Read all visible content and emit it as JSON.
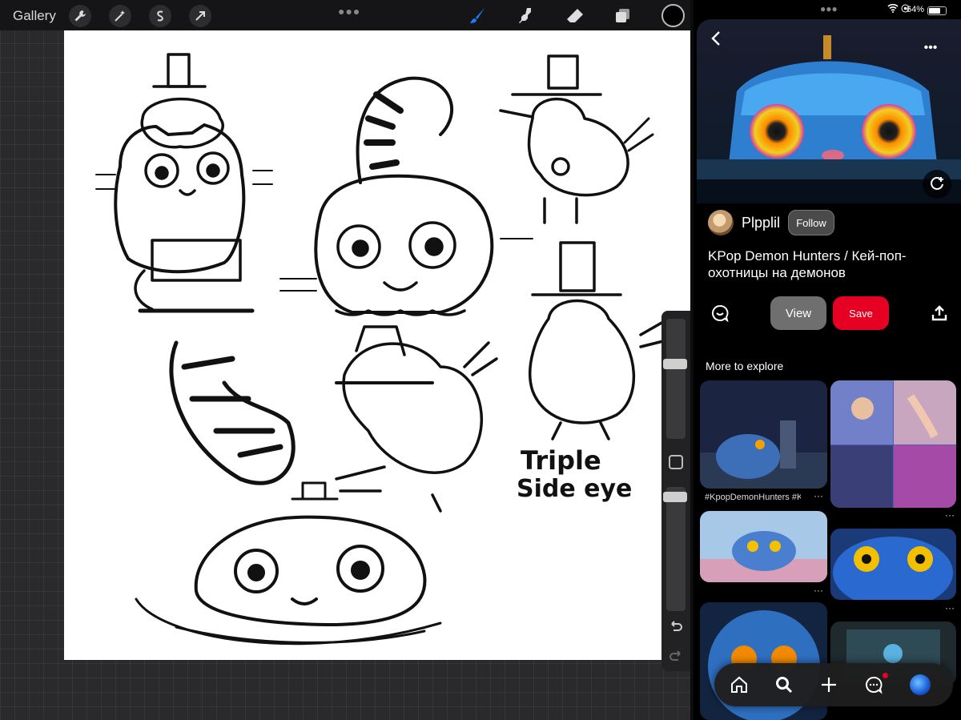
{
  "drawing_app": {
    "gallery_label": "Gallery",
    "toolbar_tools": [
      "wrench-icon",
      "magic-wand-icon",
      "selection-icon",
      "transform-arrow-icon"
    ],
    "right_tools": [
      "brush-icon",
      "smudge-icon",
      "eraser-icon",
      "layers-icon"
    ],
    "accent_color": "#1e7cff",
    "current_color": "#000000",
    "canvas_text": [
      "Triple",
      "Side eye"
    ]
  },
  "pin_viewer": {
    "status": {
      "battery_percent": "64%"
    },
    "author": {
      "name": "Plpplil",
      "follow_label": "Follow"
    },
    "title": "KPop Demon Hunters / Кей-поп-охотницы на демонов",
    "actions": {
      "view_label": "View",
      "save_label": "Save"
    },
    "more_to_explore": "More to explore",
    "tiles": [
      {
        "caption": "#KpopDemonHunters #K..."
      }
    ],
    "colors": {
      "save_red": "#e60023",
      "view_gray": "#6f6f6f"
    }
  }
}
